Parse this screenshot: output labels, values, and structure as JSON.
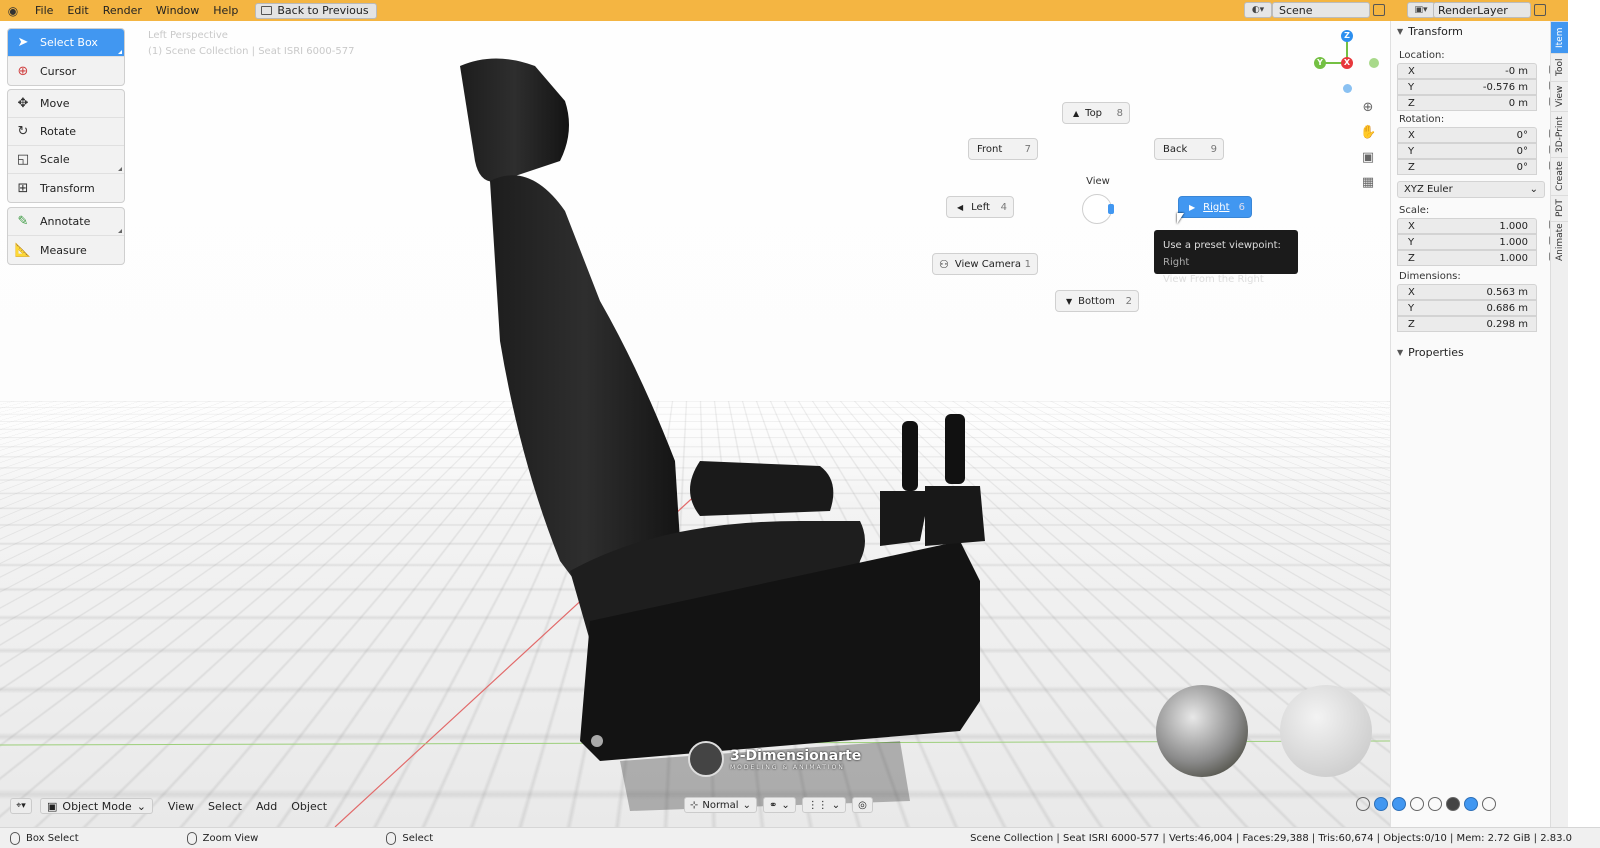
{
  "menu": {
    "items": [
      "File",
      "Edit",
      "Render",
      "Window",
      "Help"
    ],
    "back_label": "Back to Previous"
  },
  "scene": {
    "name": "Scene",
    "render_layer": "RenderLayer"
  },
  "viewport": {
    "view_name": "Left Perspective",
    "collection_info": "(1) Scene Collection | Seat ISRI 6000-577"
  },
  "toolbar": {
    "tools": [
      {
        "label": "Select Box",
        "active": true
      },
      {
        "label": "Cursor"
      },
      {
        "label": "Move"
      },
      {
        "label": "Rotate"
      },
      {
        "label": "Scale"
      },
      {
        "label": "Transform"
      },
      {
        "label": "Annotate"
      },
      {
        "label": "Measure"
      }
    ]
  },
  "pie": {
    "title": "View",
    "top": {
      "label": "Top",
      "key": "8"
    },
    "front": {
      "label": "Front",
      "key": "7"
    },
    "back": {
      "label": "Back",
      "key": "9"
    },
    "left": {
      "label": "Left",
      "key": "4"
    },
    "right": {
      "label": "Right",
      "key": "6"
    },
    "camera": {
      "label": "View Camera",
      "key": "1"
    },
    "bottom": {
      "label": "Bottom",
      "key": "2"
    }
  },
  "tooltip": {
    "line1": "Use a preset viewpoint:",
    "line1_value": "Right",
    "line2": "View From the Right"
  },
  "gizmo": {
    "z": "Z",
    "y": "Y",
    "x": "X"
  },
  "watermark": {
    "title": "3-Dimensionarte",
    "subtitle": "MODELING & ANIMATION"
  },
  "properties": {
    "transform_title": "Transform",
    "location_label": "Location:",
    "location": [
      {
        "axis": "X",
        "value": "-0 m"
      },
      {
        "axis": "Y",
        "value": "-0.576 m"
      },
      {
        "axis": "Z",
        "value": "0 m"
      }
    ],
    "rotation_label": "Rotation:",
    "rotation": [
      {
        "axis": "X",
        "value": "0°"
      },
      {
        "axis": "Y",
        "value": "0°"
      },
      {
        "axis": "Z",
        "value": "0°"
      }
    ],
    "rotation_mode": "XYZ Euler",
    "scale_label": "Scale:",
    "scale": [
      {
        "axis": "X",
        "value": "1.000"
      },
      {
        "axis": "Y",
        "value": "1.000"
      },
      {
        "axis": "Z",
        "value": "1.000"
      }
    ],
    "dimensions_label": "Dimensions:",
    "dimensions": [
      {
        "axis": "X",
        "value": "0.563 m"
      },
      {
        "axis": "Y",
        "value": "0.686 m"
      },
      {
        "axis": "Z",
        "value": "0.298 m"
      }
    ],
    "properties_title": "Properties"
  },
  "side_tabs": [
    "Item",
    "Tool",
    "View",
    "3D-Print",
    "Create",
    "PDT",
    "Animate"
  ],
  "header": {
    "mode": "Object Mode",
    "menus": [
      "View",
      "Select",
      "Add",
      "Object"
    ],
    "orientation": "Normal"
  },
  "status": {
    "left": "Box Select",
    "middle": "Zoom View",
    "right": "Select",
    "stats": "Scene Collection | Seat ISRI 6000-577 | Verts:46,004 | Faces:29,388 | Tris:60,674 | Objects:0/10 | Mem: 2.72 GiB | 2.83.0"
  },
  "colors": {
    "accent": "#4197f1",
    "topbar": "#f4b542",
    "axis_x": "#e8383c",
    "axis_y": "#74c043",
    "axis_z": "#2c8fef"
  }
}
